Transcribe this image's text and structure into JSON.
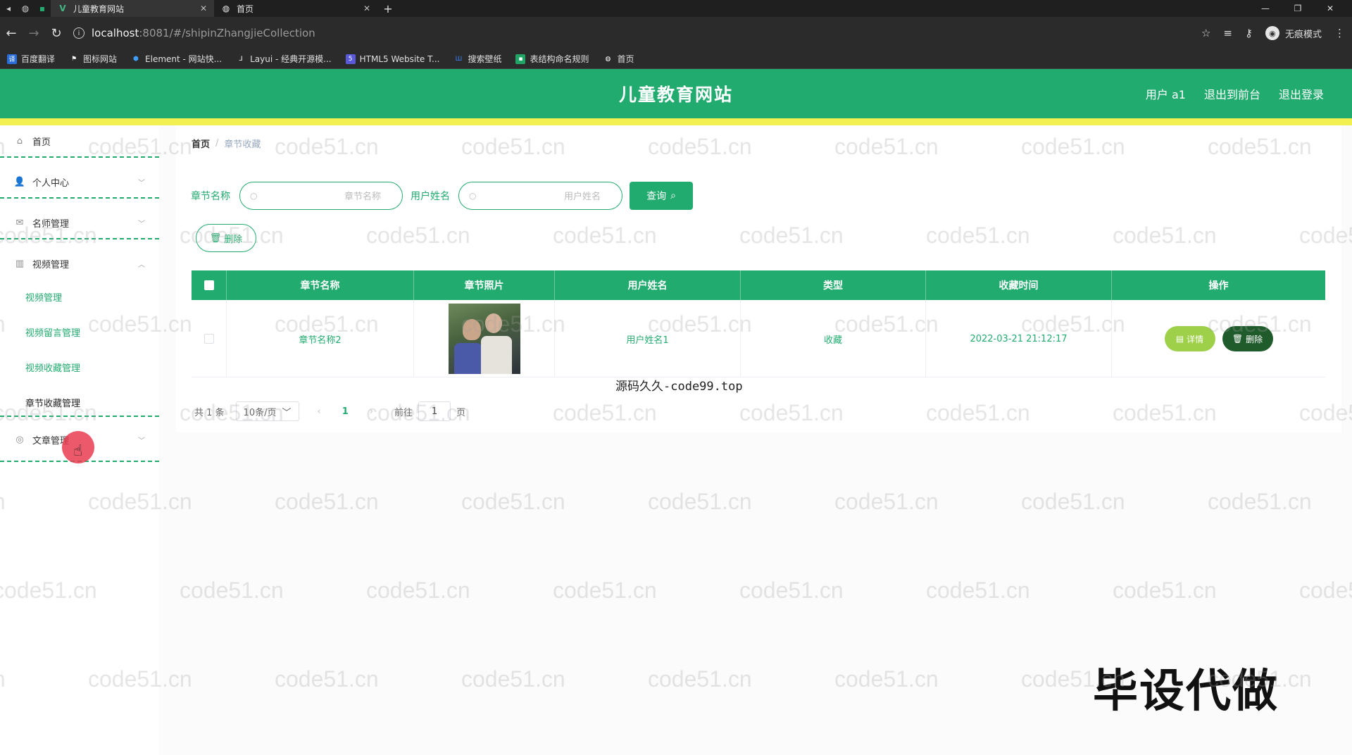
{
  "browser": {
    "tabs": [
      {
        "title": "儿童教育网站",
        "active": true
      },
      {
        "title": "首页",
        "active": false
      }
    ],
    "url_host": "localhost",
    "url_path": ":8081/#/shipinZhangjieCollection",
    "profile_label": "无痕模式",
    "bookmarks": [
      "百度翻译",
      "图标网站",
      "Element - 网站快...",
      "Layui - 经典开源模...",
      "HTML5 Website T...",
      "搜索壁纸",
      "表结构命名规则",
      "首页"
    ]
  },
  "header": {
    "title": "儿童教育网站",
    "user": "用户 a1",
    "back_to_front": "退出到前台",
    "logout": "退出登录"
  },
  "sidebar": {
    "items": [
      {
        "label": "首页",
        "icon": "home-icon"
      },
      {
        "label": "个人中心",
        "icon": "user-icon"
      },
      {
        "label": "名师管理",
        "icon": "mail-icon"
      },
      {
        "label": "视频管理",
        "icon": "chart-icon"
      }
    ],
    "sub_items": [
      "视频管理",
      "视频留言管理",
      "视频收藏管理",
      "章节收藏管理"
    ],
    "article": {
      "label": "文章管理",
      "icon": "compass-icon"
    }
  },
  "breadcrumb": {
    "home": "首页",
    "sep": "/",
    "current": "章节收藏"
  },
  "search": {
    "chapter_label": "章节名称",
    "chapter_placeholder": "章节名称",
    "user_label": "用户姓名",
    "user_placeholder": "用户姓名",
    "query_button": "查询"
  },
  "toolbar": {
    "delete_button": "删除"
  },
  "table": {
    "headers": [
      "章节名称",
      "章节照片",
      "用户姓名",
      "类型",
      "收藏时间",
      "操作"
    ],
    "rows": [
      {
        "chapter_name": "章节名称2",
        "user_name": "用户姓名1",
        "type": "收藏",
        "time": "2022-03-21 21:12:17",
        "detail": "详情",
        "delete": "删除"
      }
    ]
  },
  "pagination": {
    "total": "共 1 条",
    "page_size": "10条/页",
    "current_page": "1",
    "goto_prefix": "前往",
    "goto_value": "1",
    "goto_suffix": "页"
  },
  "overlay": {
    "source_text": "源码久久-code99.top",
    "big_text": "毕设代做",
    "watermark": "code51.cn"
  },
  "colors": {
    "primary": "#22ab6f",
    "accent_yellow": "#f2f051",
    "detail": "#9ed04a",
    "delete_dark": "#1f5b2b"
  }
}
